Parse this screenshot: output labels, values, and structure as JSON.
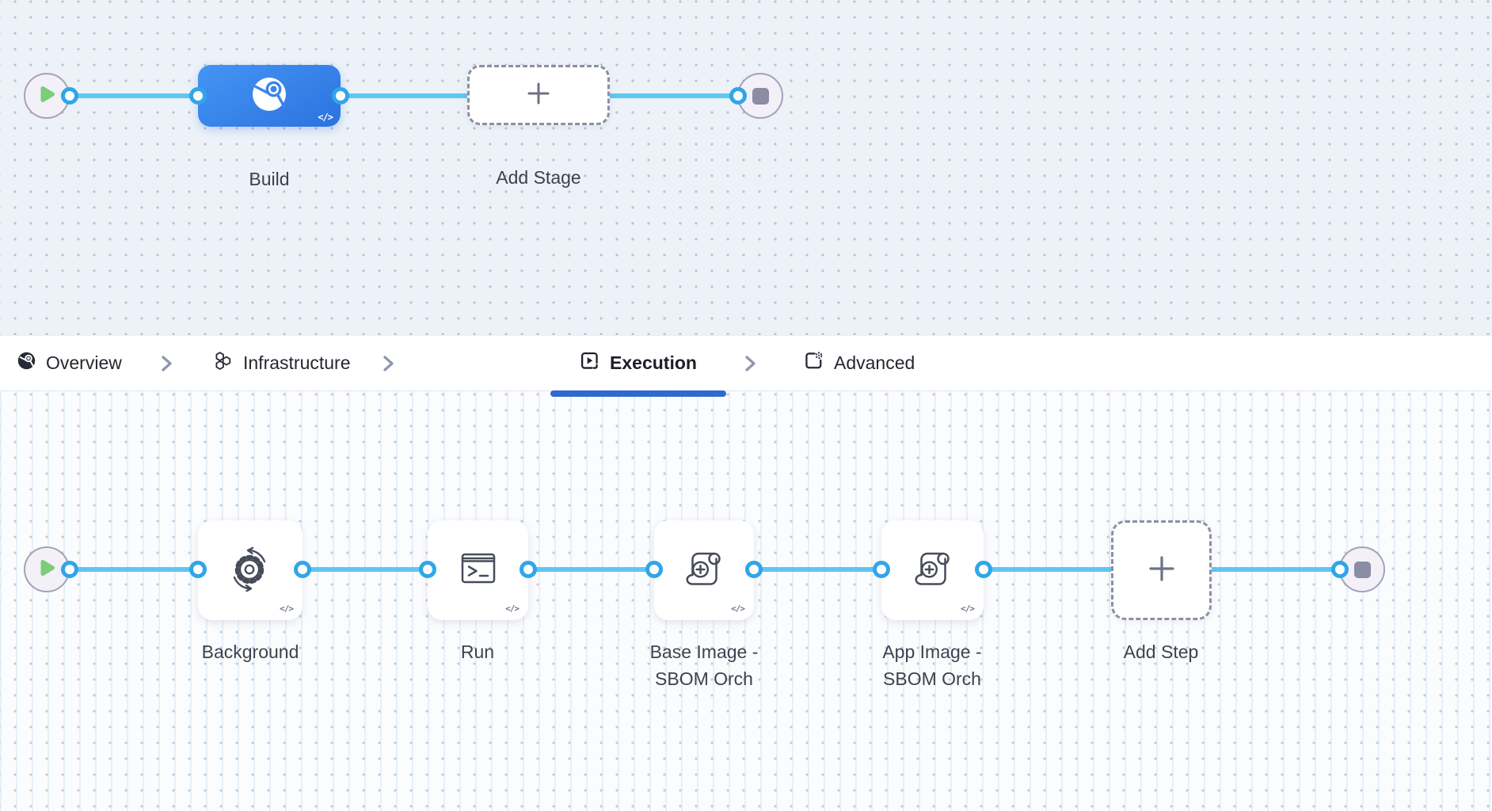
{
  "stage_pipeline": {
    "build_stage": {
      "label": "Build",
      "code_glyph": "</>"
    },
    "add_stage": {
      "label": "Add Stage"
    }
  },
  "tab_bar": {
    "tabs": [
      {
        "label": "Overview",
        "icon": "ci-overview-icon",
        "active": false
      },
      {
        "label": "Infrastructure",
        "icon": "hexagons-icon",
        "active": false
      },
      {
        "label": "Execution",
        "icon": "play-square-icon",
        "active": true
      },
      {
        "label": "Advanced",
        "icon": "square-gear-icon",
        "active": false
      }
    ]
  },
  "execution_pipeline": {
    "steps": [
      {
        "label": "Background",
        "icon": "sync-gear-icon",
        "code_glyph": "</>"
      },
      {
        "label": "Run",
        "icon": "terminal-icon",
        "code_glyph": "</>"
      },
      {
        "label": "Base Image - SBOM Orch",
        "icon": "scroll-plus-icon",
        "code_glyph": "</>"
      },
      {
        "label": "App Image - SBOM Orch",
        "icon": "scroll-plus-icon",
        "code_glyph": "</>"
      }
    ],
    "add_step": {
      "label": "Add Step"
    }
  },
  "colors": {
    "edge": "#5ec6f3",
    "port_ring": "#2fa6e9",
    "active_tab_underline": "#2f68d3",
    "stage_node_gradient_from": "#4495f4",
    "stage_node_gradient_to": "#2c72df",
    "play_green": "#7bcd76",
    "stop_gray": "#8c8ca5"
  }
}
